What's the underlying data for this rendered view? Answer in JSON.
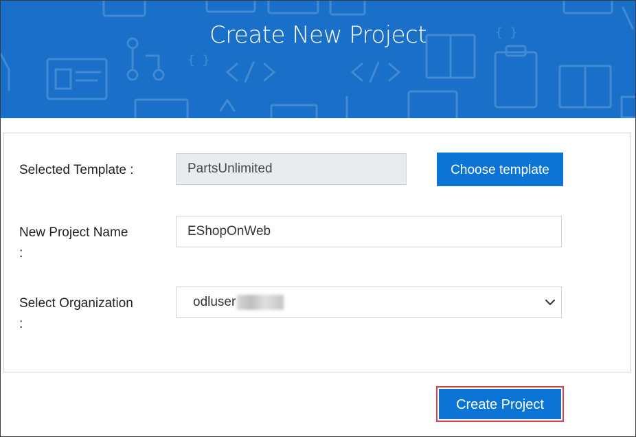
{
  "header": {
    "title": "Create New Project"
  },
  "form": {
    "template": {
      "label": "Selected Template :",
      "value": "PartsUnlimited",
      "button": "Choose template"
    },
    "project_name": {
      "label_line1": "New Project Name",
      "label_line2": ":",
      "value": "EShopOnWeb"
    },
    "organization": {
      "label_line1": "Select Organization",
      "label_line2": ":",
      "value": "odluser"
    }
  },
  "actions": {
    "create_label": "Create Project"
  },
  "colors": {
    "banner": "#1a6fc8",
    "button": "#0c74d5",
    "highlight": "#e0414b"
  },
  "icons": [
    "chevron-down-icon"
  ]
}
